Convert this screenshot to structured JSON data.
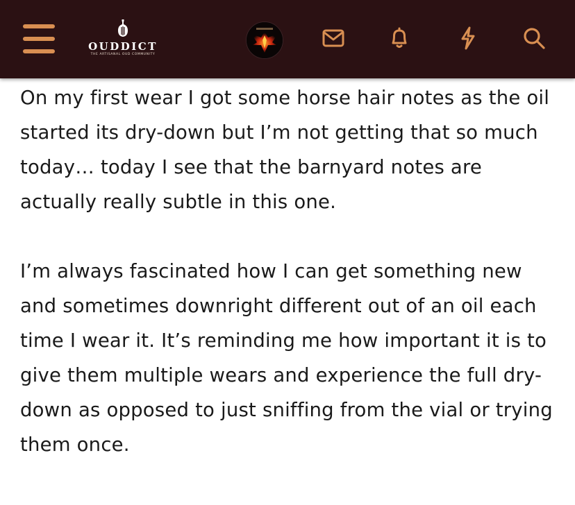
{
  "header": {
    "logo": {
      "name": "OUDDICT",
      "tagline": "THE ARTISANAL OUD COMMUNITY"
    },
    "menu_icon": "hamburger-menu-icon",
    "avatar_icon": "phoenix-avatar",
    "nav_icons": [
      "mail-icon",
      "bell-icon",
      "lightning-bolt-icon",
      "search-icon"
    ],
    "colors": {
      "bar_background": "#2b1113",
      "icon_accent": "#d98f52"
    }
  },
  "post": {
    "paragraphs": [
      "On my first wear I got some horse hair notes as the oil started its dry-down but I’m not getting that so much today… today I see that the barnyard notes are actually really subtle in this one.",
      "I’m always fascinated how I can get something new and sometimes downright different out of an oil each time I wear it. It’s reminding me how important it is to give them multiple wears and experience the full dry-down as opposed to just sniffing from the vial or trying them once."
    ]
  }
}
